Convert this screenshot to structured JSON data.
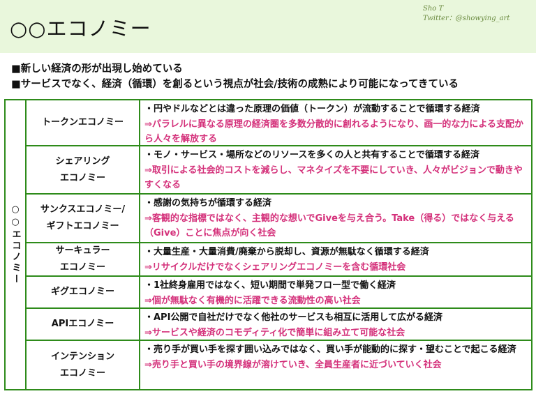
{
  "header": {
    "title": "○○エコノミー",
    "author": "Sho T",
    "twitter": "Twitter：@showying_art"
  },
  "bullets": [
    "■新しい経済の形が出現し始めている",
    "■サービスでなく、経済（循環）を創るという視点が社会/技術の成熟により可能になってきている"
  ],
  "side_label": "○○エコノミー",
  "rows": [
    {
      "name": "トークンエコノミー",
      "line1": "・円やドルなどとは違った原理の価値（トークン）が流動することで循環する経済",
      "line2": "⇒パラレルに異なる原理の経済圏を多数分散的に創れるようになり、画一的な力による支配から人々を解放する"
    },
    {
      "name": "シェアリング\nエコノミー",
      "line1": "・モノ・サービス・場所などのリソースを多くの人と共有することで循環する経済",
      "line2": "⇒取引による社会的コストを減らし、マネタイズを不要にしていき、人々がビジョンで動きやすくなる"
    },
    {
      "name": "サンクスエコノミー/\nギフトエコノミー",
      "line1": "・感謝の気持ちが循環する経済",
      "line2": "⇒客観的な指標ではなく、主観的な想いでGiveを与え合う。Take（得る）ではなく与える（Give）ことに焦点が向く社会"
    },
    {
      "name": "サーキュラー\nエコノミー",
      "line1": "・大量生産・大量消費/廃棄から脱却し、資源が無駄なく循環する経済",
      "line2": "⇒リサイクルだけでなくシェアリングエコノミーを含む循環社会"
    },
    {
      "name": "ギグエコノミー",
      "line1": "・1社終身雇用ではなく、短い期間で単発フロー型で働く経済",
      "line2": "⇒個が無駄なく有機的に活躍できる流動性の高い社会"
    },
    {
      "name": "APIエコノミー",
      "line1": "・API公開で自社だけでなく他社のサービスも相互に活用して広がる経済",
      "line2": "⇒サービスや経済のコモディティ化で簡単に組み立て可能な社会"
    },
    {
      "name": "インテンション\nエコノミー",
      "line1": "・売り手が買い手を探す囲い込みではなく、買い手が能動的に探す・望むことで起こる経済",
      "line2": "⇒売り手と買い手の境界線が溶けていき、全員生産者に近づいていく社会"
    }
  ],
  "colors": {
    "header_bg": "#e9f7dc",
    "border": "#2e8b1a",
    "accent_text": "#d4307a",
    "credit_text": "#6a8a3f"
  }
}
